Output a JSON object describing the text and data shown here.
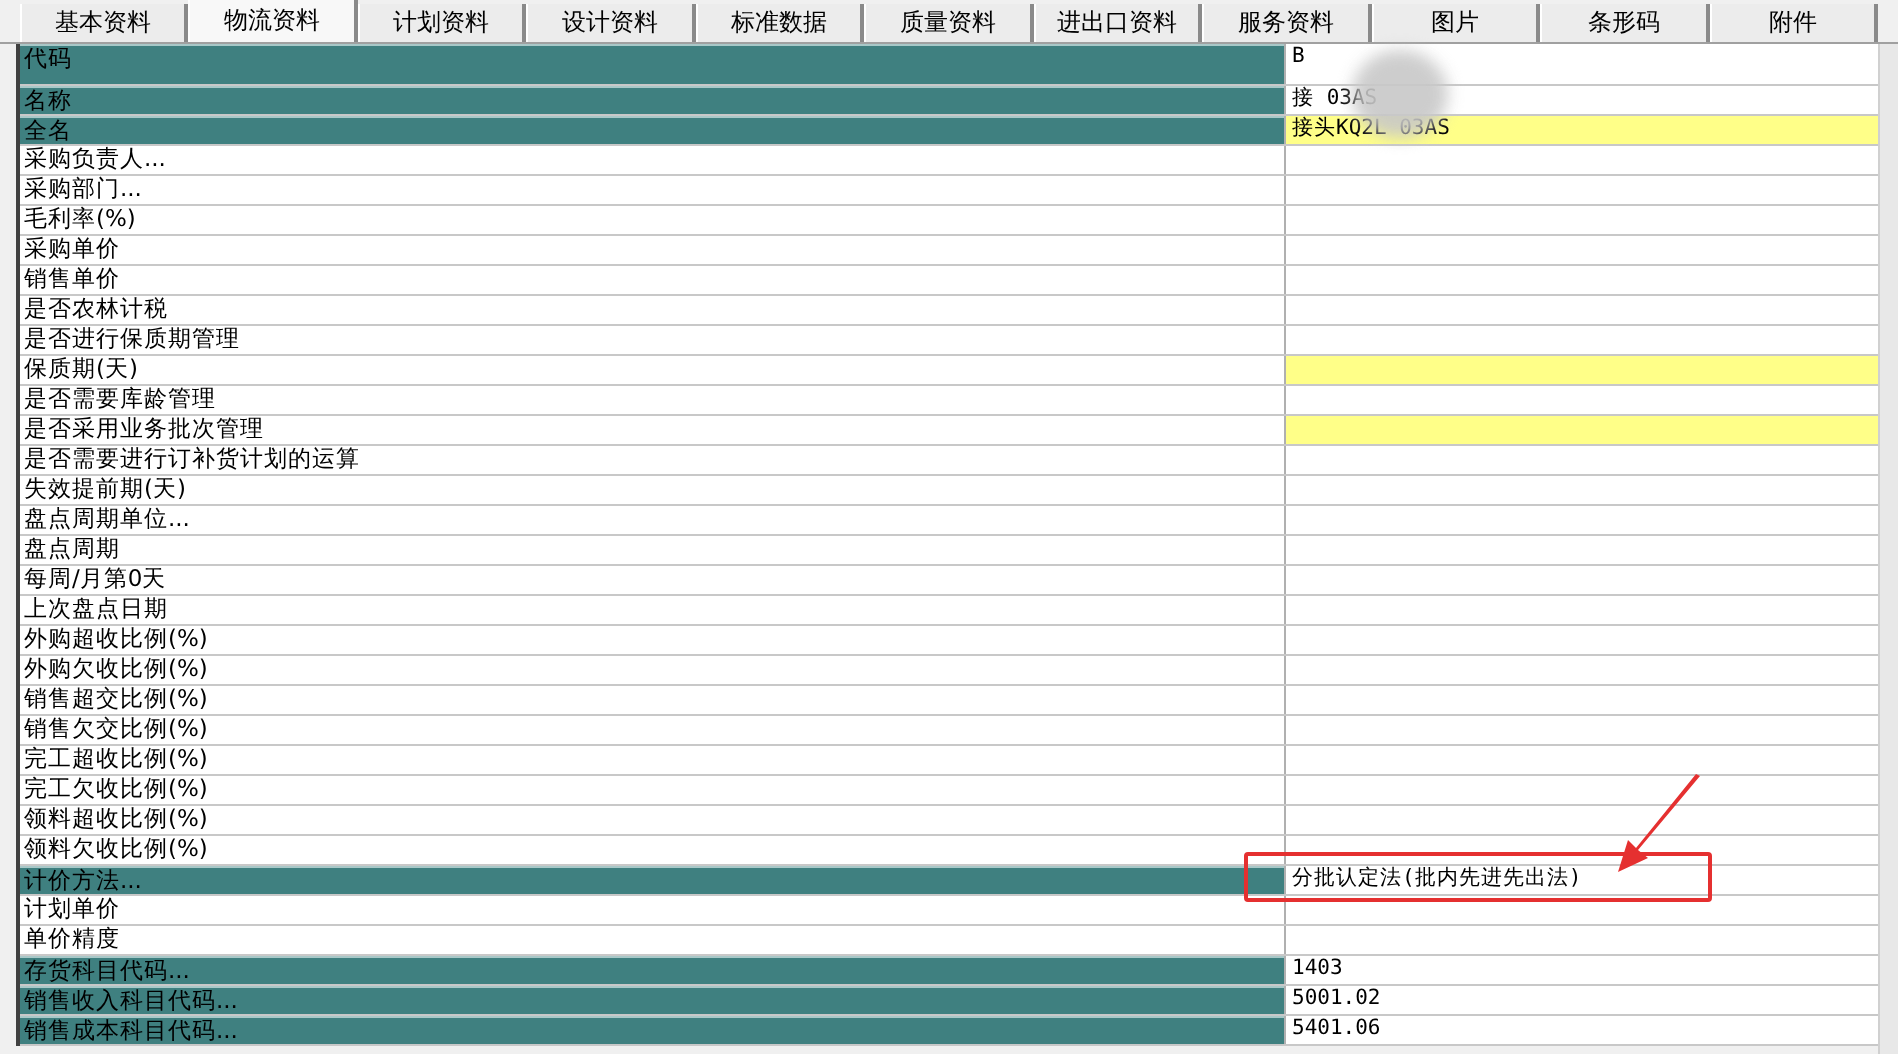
{
  "tabs": [
    {
      "label": "基本资料",
      "selected": false
    },
    {
      "label": "物流资料",
      "selected": true
    },
    {
      "label": "计划资料",
      "selected": false
    },
    {
      "label": "设计资料",
      "selected": false
    },
    {
      "label": "标准数据",
      "selected": false
    },
    {
      "label": "质量资料",
      "selected": false
    },
    {
      "label": "进出口资料",
      "selected": false
    },
    {
      "label": "服务资料",
      "selected": false
    },
    {
      "label": "图片",
      "selected": false
    },
    {
      "label": "条形码",
      "selected": false
    },
    {
      "label": "附件",
      "selected": false
    }
  ],
  "rows": [
    {
      "label": "代码",
      "value": "B",
      "highlighted": true,
      "required": false,
      "tall": true
    },
    {
      "label": "名称",
      "value": "接 03AS",
      "highlighted": true,
      "required": false
    },
    {
      "label": "全名",
      "value": "接头KQ2L 03AS",
      "highlighted": true,
      "required": true
    },
    {
      "label": "采购负责人...",
      "highlighted": false,
      "required": false
    },
    {
      "label": "采购部门...",
      "highlighted": false,
      "required": false
    },
    {
      "label": "毛利率(%)",
      "highlighted": false,
      "required": false
    },
    {
      "label": "采购单价",
      "highlighted": false,
      "required": false
    },
    {
      "label": "销售单价",
      "highlighted": false,
      "required": false
    },
    {
      "label": "是否农林计税",
      "highlighted": false,
      "required": false
    },
    {
      "label": "是否进行保质期管理",
      "highlighted": false,
      "required": false
    },
    {
      "label": "保质期(天)",
      "highlighted": false,
      "required": true
    },
    {
      "label": "是否需要库龄管理",
      "highlighted": false,
      "required": false
    },
    {
      "label": "是否采用业务批次管理",
      "highlighted": false,
      "required": true
    },
    {
      "label": "是否需要进行订补货计划的运算",
      "highlighted": false,
      "required": false
    },
    {
      "label": "失效提前期(天)",
      "highlighted": false,
      "required": false
    },
    {
      "label": "盘点周期单位...",
      "highlighted": false,
      "required": false
    },
    {
      "label": "盘点周期",
      "highlighted": false,
      "required": false
    },
    {
      "label": "每周/月第0天",
      "highlighted": false,
      "required": false
    },
    {
      "label": "上次盘点日期",
      "highlighted": false,
      "required": false
    },
    {
      "label": "外购超收比例(%)",
      "highlighted": false,
      "required": false
    },
    {
      "label": "外购欠收比例(%)",
      "highlighted": false,
      "required": false
    },
    {
      "label": "销售超交比例(%)",
      "highlighted": false,
      "required": false
    },
    {
      "label": "销售欠交比例(%)",
      "highlighted": false,
      "required": false
    },
    {
      "label": "完工超收比例(%)",
      "highlighted": false,
      "required": false
    },
    {
      "label": "完工欠收比例(%)",
      "highlighted": false,
      "required": false
    },
    {
      "label": "领料超收比例(%)",
      "highlighted": false,
      "required": false
    },
    {
      "label": "领料欠收比例(%)",
      "highlighted": false,
      "required": false
    },
    {
      "label": "计价方法...",
      "value": "分批认定法(批内先进先出法)",
      "highlighted": true,
      "required": false,
      "annotated": true
    },
    {
      "label": "计划单价",
      "highlighted": false,
      "required": false
    },
    {
      "label": "单价精度",
      "highlighted": false,
      "required": false
    },
    {
      "label": "存货科目代码...",
      "value": "1403",
      "highlighted": true,
      "required": false
    },
    {
      "label": "销售收入科目代码...",
      "value": "5001.02",
      "highlighted": true,
      "required": false
    },
    {
      "label": "销售成本科目代码...",
      "value": "5401.06",
      "highlighted": true,
      "required": false
    }
  ]
}
